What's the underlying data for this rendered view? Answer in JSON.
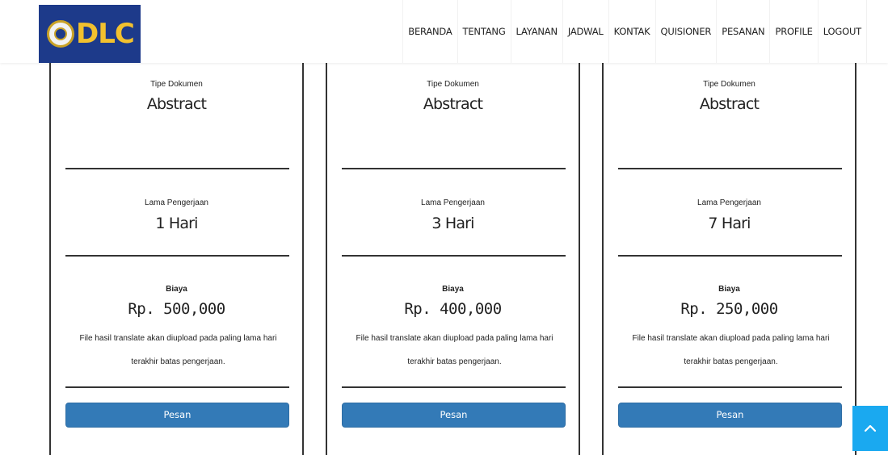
{
  "brand": {
    "logo_text": "DLC",
    "primary_color": "#1d3a8a",
    "accent_color": "#f2c12e"
  },
  "nav": {
    "items": [
      "BERANDA",
      "TENTANG",
      "LAYANAN",
      "JADWAL",
      "KONTAK",
      "QUISIONER",
      "PESANAN",
      "PROFILE",
      "LOGOUT"
    ]
  },
  "cards": [
    {
      "doc_type_label": "Tipe Dokumen",
      "doc_type": "Abstract",
      "duration_label": "Lama Pengerjaan",
      "duration": "1 Hari",
      "price_label": "Biaya",
      "price": "Rp. 500,000",
      "note_line1": "File hasil translate akan diupload pada paling lama hari",
      "note_line2": "terakhir batas pengerjaan.",
      "button_label": "Pesan"
    },
    {
      "doc_type_label": "Tipe Dokumen",
      "doc_type": "Abstract",
      "duration_label": "Lama Pengerjaan",
      "duration": "3 Hari",
      "price_label": "Biaya",
      "price": "Rp. 400,000",
      "note_line1": "File hasil translate akan diupload pada paling lama hari",
      "note_line2": "terakhir batas pengerjaan.",
      "button_label": "Pesan"
    },
    {
      "doc_type_label": "Tipe Dokumen",
      "doc_type": "Abstract",
      "duration_label": "Lama Pengerjaan",
      "duration": "7 Hari",
      "price_label": "Biaya",
      "price": "Rp. 250,000",
      "note_line1": "File hasil translate akan diupload pada paling lama hari",
      "note_line2": "terakhir batas pengerjaan.",
      "button_label": "Pesan"
    }
  ],
  "scroll_top": {
    "icon": "chevron-up-icon",
    "color": "#1aa9f0"
  }
}
